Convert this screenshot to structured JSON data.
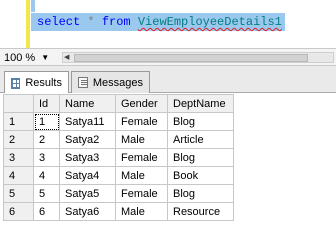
{
  "editor": {
    "query": {
      "keyword_select": "select",
      "star": "*",
      "keyword_from": "from",
      "view_name": "ViewEmployeeDetails1"
    }
  },
  "zoom": {
    "value": "100 %"
  },
  "tabs": [
    {
      "label": "Results",
      "active": true
    },
    {
      "label": "Messages",
      "active": false
    }
  ],
  "results": {
    "columns": [
      "Id",
      "Name",
      "Gender",
      "DeptName"
    ],
    "rows": [
      {
        "rownum": "1",
        "Id": "1",
        "Name": "Satya11",
        "Gender": "Female",
        "DeptName": "Blog"
      },
      {
        "rownum": "2",
        "Id": "2",
        "Name": "Satya2",
        "Gender": "Male",
        "DeptName": "Article"
      },
      {
        "rownum": "3",
        "Id": "3",
        "Name": "Satya3",
        "Gender": "Female",
        "DeptName": "Blog"
      },
      {
        "rownum": "4",
        "Id": "4",
        "Name": "Satya4",
        "Gender": "Male",
        "DeptName": "Book"
      },
      {
        "rownum": "5",
        "Id": "5",
        "Name": "Satya5",
        "Gender": "Female",
        "DeptName": "Blog"
      },
      {
        "rownum": "6",
        "Id": "6",
        "Name": "Satya6",
        "Gender": "Male",
        "DeptName": "Resource"
      }
    ]
  },
  "colors": {
    "selection": "#9bc8ee",
    "keyword": "#0000ff",
    "identifier": "#008080",
    "gutter": "#f0e84a"
  }
}
